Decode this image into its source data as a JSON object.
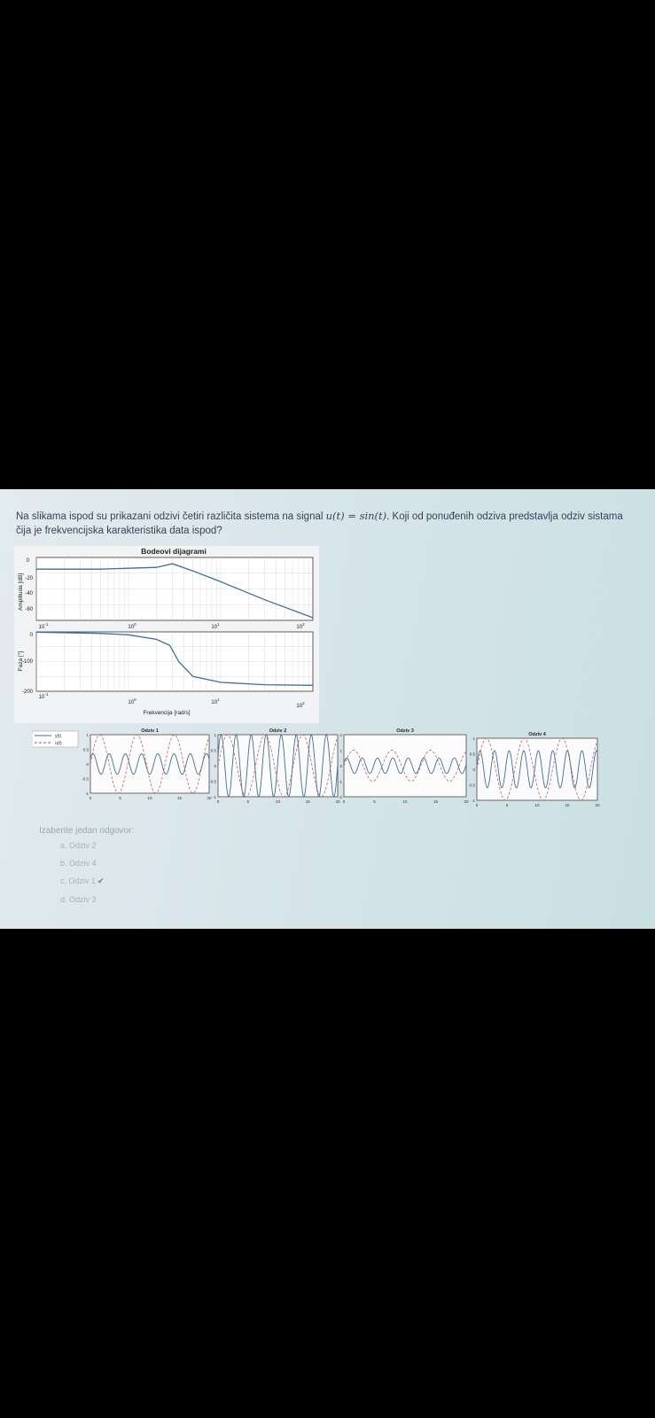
{
  "question": {
    "text_before": "Na slikama ispod  su prikazani odzivi četiri različita sistema na signal ",
    "math_expr": "u(t) = sin(t)",
    "text_after": ". Koji od ponuđenih odziva predstavlja odziv sistama čija je frekvencijska karakteristika data ispod?"
  },
  "bode": {
    "title": "Bodeovi dijagrami",
    "amp_ylabel": "Amplituda [dB]",
    "phase_ylabel": "Faza [°]",
    "xlabel": "Frekvencija [rad/s]",
    "amp_yticks": [
      "0",
      "-20",
      "-40",
      "-60"
    ],
    "phase_yticks": [
      "0",
      "-100",
      "-200"
    ],
    "xtick_base": [
      "10",
      "10",
      "10",
      "10"
    ],
    "xtick_exp": [
      "-1",
      "0",
      "1",
      "2"
    ]
  },
  "chart_data": [
    {
      "type": "line",
      "title": "Bodeovi dijagrami",
      "xlabel": "Frekvencija [rad/s]",
      "ylabel": "Amplituda [dB]",
      "xscale": "log",
      "xlim": [
        0.1,
        100
      ],
      "ylim": [
        -70,
        0
      ],
      "grid": true,
      "x": [
        0.1,
        0.5,
        1,
        2,
        3,
        5,
        10,
        30,
        100
      ],
      "y": [
        -13,
        -13,
        -12,
        -11,
        -7,
        -15,
        -27,
        -47,
        -67
      ]
    },
    {
      "type": "line",
      "xlabel": "Frekvencija [rad/s]",
      "ylabel": "Faza [°]",
      "xscale": "log",
      "xlim": [
        0.1,
        100
      ],
      "ylim": [
        -200,
        0
      ],
      "grid": true,
      "x": [
        0.1,
        0.5,
        1,
        2,
        2.8,
        3.5,
        5,
        10,
        30,
        100
      ],
      "y": [
        -1,
        -5,
        -10,
        -25,
        -45,
        -100,
        -150,
        -170,
        -178,
        -180
      ]
    },
    {
      "type": "line",
      "title": "Odziv 1",
      "xlim": [
        0,
        20
      ],
      "ylim": [
        -1,
        1
      ],
      "series": [
        {
          "name": "y(t)",
          "amplitude": 0.35,
          "omega": 2.3,
          "phase": 0.6
        },
        {
          "name": "u(t)",
          "amplitude": 1,
          "omega": 1,
          "phase": 0
        }
      ]
    },
    {
      "type": "line",
      "title": "Odziv 2",
      "xlim": [
        0,
        20
      ],
      "ylim": [
        -1,
        1
      ],
      "series": [
        {
          "name": "y(t)",
          "amplitude": 1,
          "omega": 2.5,
          "phase": 0.3
        },
        {
          "name": "u(t)",
          "amplitude": 1,
          "omega": 1,
          "phase": 0
        }
      ]
    },
    {
      "type": "line",
      "title": "Odziv 3",
      "xlim": [
        0,
        20
      ],
      "ylim": [
        -2,
        2
      ],
      "series": [
        {
          "name": "y(t)",
          "amplitude": 0.5,
          "omega": 2.5,
          "phase": 0.4
        },
        {
          "name": "u(t)",
          "amplitude": 1,
          "omega": 1,
          "phase": 0
        }
      ]
    },
    {
      "type": "line",
      "title": "Odziv 4",
      "xlim": [
        0,
        20
      ],
      "ylim": [
        -1,
        1
      ],
      "series": [
        {
          "name": "y(t)",
          "amplitude": 0.6,
          "omega": 2.6,
          "phase": 0.2
        },
        {
          "name": "u(t)",
          "amplitude": 1,
          "omega": 1,
          "phase": 0
        }
      ]
    }
  ],
  "responses": {
    "titles": [
      "Odziv 1",
      "Odziv 2",
      "Odziv 3",
      "Odziv 4"
    ],
    "legend": [
      "y(t)",
      "u(t)"
    ],
    "xticks": [
      "0",
      "5",
      "10",
      "15",
      "20"
    ],
    "yticks_1": [
      "1",
      "0.5",
      "0",
      "-0.5",
      "-1"
    ],
    "yticks_2": [
      "1",
      "0.5",
      "0",
      "-0.5",
      "-1"
    ],
    "yticks_3": [
      "2",
      "1",
      "0",
      "-1",
      "-2"
    ],
    "yticks_4": [
      "1",
      "0.5",
      "0",
      "-0.5",
      "-1"
    ]
  },
  "answers": {
    "prompt": "Izaberite jedan odgovor:",
    "options": [
      "a. Odziv 2",
      "b. Odziv 4",
      "c. Odziv 1",
      "d. Odziv 3"
    ],
    "checkmark": "✔"
  },
  "colors": {
    "response_line": "#3c6f9f",
    "input_line": "#c04a4a",
    "bode_line": "#3c6f9f",
    "grid": "#c8ccd0"
  }
}
